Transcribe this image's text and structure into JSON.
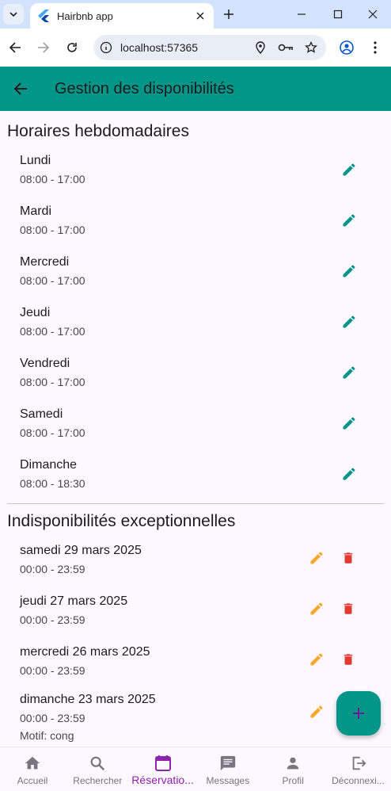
{
  "browser": {
    "tab_title": "Hairbnb app",
    "url": "localhost:57365"
  },
  "colors": {
    "primary": "#009688",
    "edit_green": "#009688",
    "edit_orange": "#f9a825",
    "delete_red": "#e53935",
    "nav_active": "#8e24aa"
  },
  "appbar": {
    "title": "Gestion des disponibilités"
  },
  "weekly": {
    "title": "Horaires hebdomadaires",
    "days": [
      {
        "day": "Lundi",
        "hours": "08:00 - 17:00"
      },
      {
        "day": "Mardi",
        "hours": "08:00 - 17:00"
      },
      {
        "day": "Mercredi",
        "hours": "08:00 - 17:00"
      },
      {
        "day": "Jeudi",
        "hours": "08:00 - 17:00"
      },
      {
        "day": "Vendredi",
        "hours": "08:00 - 17:00"
      },
      {
        "day": "Samedi",
        "hours": "08:00 - 17:00"
      },
      {
        "day": "Dimanche",
        "hours": "08:00 - 18:30"
      }
    ]
  },
  "exceptions": {
    "title": "Indisponibilités exceptionnelles",
    "items": [
      {
        "date": "samedi 29 mars 2025",
        "hours": "00:00 - 23:59"
      },
      {
        "date": "jeudi 27 mars 2025",
        "hours": "00:00 - 23:59"
      },
      {
        "date": "mercredi 26 mars 2025",
        "hours": "00:00 - 23:59"
      },
      {
        "date": "dimanche 23 mars 2025",
        "hours": "00:00 - 23:59",
        "reason": "Motif: cong"
      }
    ]
  },
  "fab": {
    "icon": "plus-icon"
  },
  "bottom_nav": [
    {
      "label": "Accueil",
      "icon": "home-icon"
    },
    {
      "label": "Rechercher",
      "icon": "search-icon"
    },
    {
      "label": "Réservatio...",
      "icon": "calendar-icon"
    },
    {
      "label": "Messages",
      "icon": "message-icon"
    },
    {
      "label": "Profil",
      "icon": "person-icon"
    },
    {
      "label": "Déconnexi...",
      "icon": "logout-icon"
    }
  ]
}
